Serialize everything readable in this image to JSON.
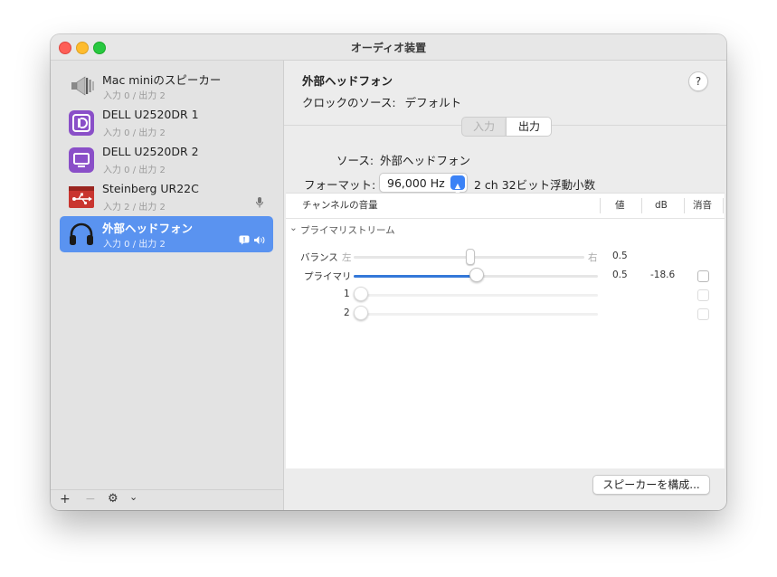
{
  "window": {
    "title": "オーディオ装置"
  },
  "devices": [
    {
      "name": "Mac miniのスピーカー",
      "io": "入力 0 / 出力 2",
      "icon": "speaker-icon"
    },
    {
      "name": "DELL U2520DR 1",
      "io": "入力 0 / 出力 2",
      "icon": "displayport-icon"
    },
    {
      "name": "DELL U2520DR 2",
      "io": "入力 0 / 出力 2",
      "icon": "display-icon"
    },
    {
      "name": "Steinberg UR22C",
      "io": "入力 2 / 出力 2",
      "icon": "usb-icon"
    },
    {
      "name": "外部ヘッドフォン",
      "io": "入力 0 / 出力 2",
      "icon": "headphones-icon",
      "selected": true
    }
  ],
  "sidebar_toolbar": {
    "add": "+",
    "remove": "−",
    "gear": "⚙",
    "chevron": "⌄"
  },
  "main": {
    "device_title": "外部ヘッドフォン",
    "clock_label": "クロックのソース:",
    "clock_value": "デフォルト",
    "help": "?",
    "tabs": {
      "input": "入力",
      "output": "出力",
      "selected": "output"
    },
    "source_label": "ソース:",
    "source_value": "外部ヘッドフォン",
    "format_label": "フォーマット:",
    "format_value": "96,000 Hz",
    "format_desc": "2 ch 32ビット浮動小数"
  },
  "table": {
    "headers": {
      "channel": "チャンネルの音量",
      "value": "値",
      "db": "dB",
      "mute": "消音"
    },
    "group": "プライマリストリーム",
    "balance": {
      "label": "バランス",
      "left": "左",
      "right": "右",
      "value": "0.5",
      "level": 0.5
    },
    "primary": {
      "label": "プライマリ",
      "value": "0.5",
      "db": "-18.6",
      "level": 0.5
    },
    "ch1": {
      "label": "1",
      "level": 0
    },
    "ch2": {
      "label": "2",
      "level": 0
    }
  },
  "configure_button": "スピーカーを構成...",
  "colors": {
    "selection": "#5a93f0",
    "accent": "#3478d9"
  }
}
